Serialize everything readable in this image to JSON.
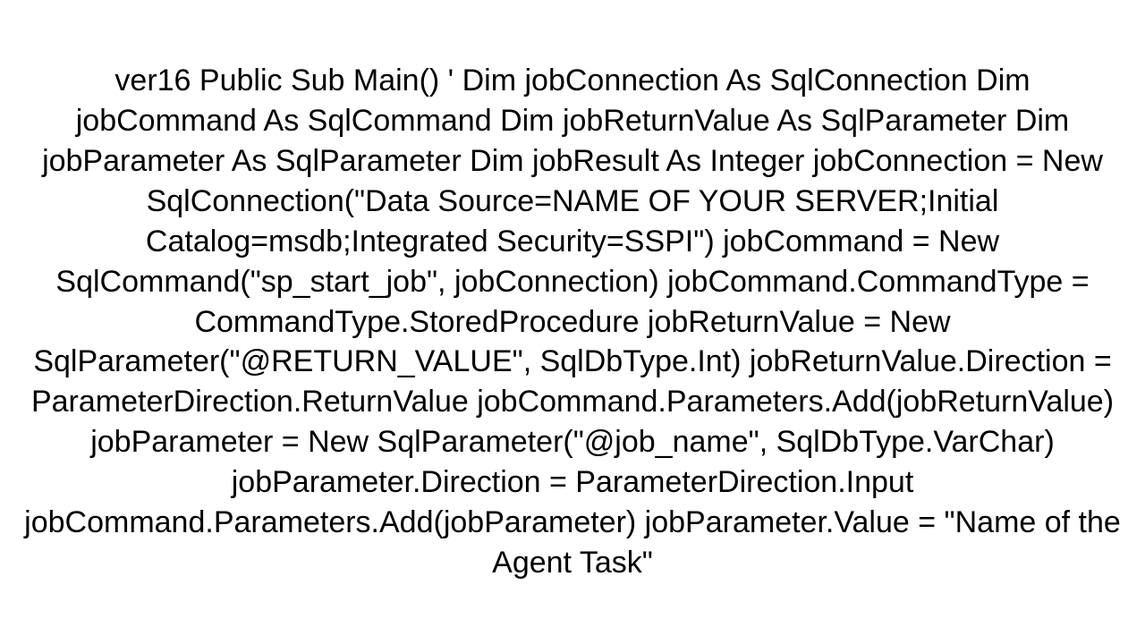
{
  "code": {
    "content": "ver16 Public Sub Main()     '     Dim jobConnection As SqlConnection     Dim jobCommand As SqlCommand     Dim jobReturnValue As SqlParameter     Dim jobParameter As SqlParameter     Dim jobResult As Integer      jobConnection = New SqlConnection(\"Data Source=NAME OF YOUR SERVER;Initial Catalog=msdb;Integrated Security=SSPI\")     jobCommand = New SqlCommand(\"sp_start_job\", jobConnection)     jobCommand.CommandType = CommandType.StoredProcedure      jobReturnValue = New SqlParameter(\"@RETURN_VALUE\", SqlDbType.Int)     jobReturnValue.Direction = ParameterDirection.ReturnValue     jobCommand.Parameters.Add(jobReturnValue)      jobParameter = New SqlParameter(\"@job_name\", SqlDbType.VarChar)     jobParameter.Direction = ParameterDirection.Input     jobCommand.Parameters.Add(jobParameter)     jobParameter.Value = \"Name of the Agent Task\""
  }
}
